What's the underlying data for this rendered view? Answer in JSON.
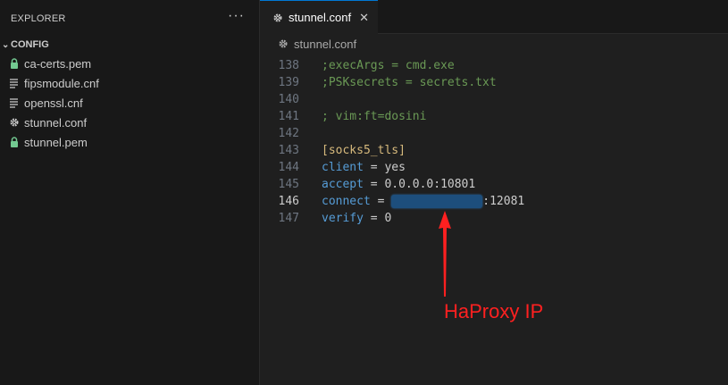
{
  "sidebar": {
    "title": "EXPLORER",
    "more": "···",
    "folder": "CONFIG",
    "files": [
      {
        "name": "ca-certs.pem",
        "icon": "lock-icon"
      },
      {
        "name": "fipsmodule.cnf",
        "icon": "lines-icon"
      },
      {
        "name": "openssl.cnf",
        "icon": "lines-icon"
      },
      {
        "name": "stunnel.conf",
        "icon": "gear-icon"
      },
      {
        "name": "stunnel.pem",
        "icon": "lock-icon"
      }
    ]
  },
  "editor": {
    "tab_label": "stunnel.conf",
    "tab_close": "✕",
    "breadcrumb": "stunnel.conf",
    "lines": [
      {
        "num": "138",
        "text": ";execArgs = cmd.exe"
      },
      {
        "num": "139",
        "text": ";PSKsecrets = secrets.txt"
      },
      {
        "num": "140",
        "text": ""
      },
      {
        "num": "141",
        "text": "; vim:ft=dosini"
      },
      {
        "num": "142",
        "text": ""
      },
      {
        "num": "143",
        "text": "[socks5_tls]"
      },
      {
        "num": "144",
        "key": "client",
        "eq": " = ",
        "value": "yes"
      },
      {
        "num": "145",
        "key": "accept",
        "eq": " = ",
        "value": "0.0.0.0:10801"
      },
      {
        "num": "146",
        "key": "connect",
        "eq": " = ",
        "value": ":12081"
      },
      {
        "num": "147",
        "key": "verify",
        "eq": " = ",
        "value": "0"
      }
    ]
  },
  "annotation": {
    "label": "HaProxy IP",
    "color": "#ff2020"
  },
  "colors": {
    "accent": "#0078d4",
    "comment": "#6a9955",
    "keyword": "#569cd6",
    "section": "#d7ba7d",
    "lock": "#73c991"
  }
}
